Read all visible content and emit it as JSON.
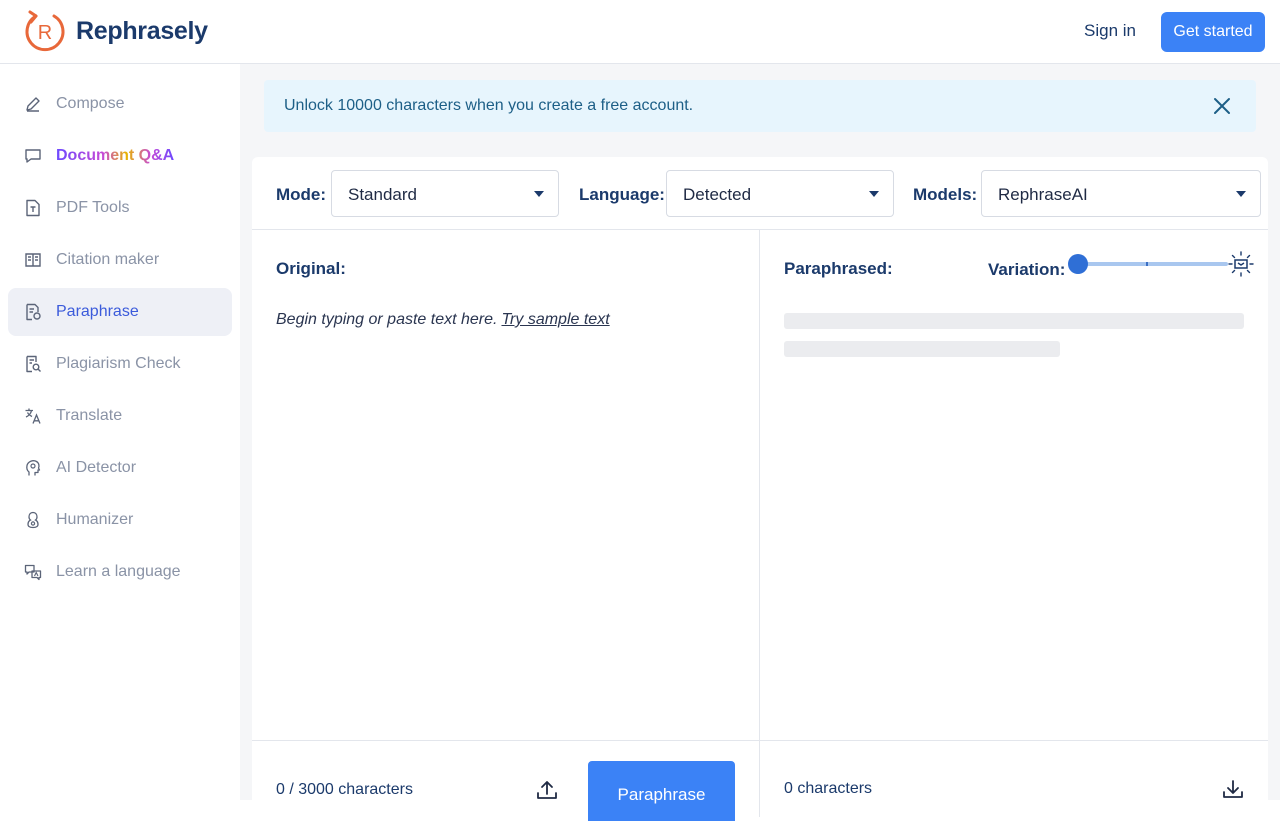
{
  "brand": {
    "name": "Rephrasely",
    "logo_letter": "R",
    "accent_color": "#e8683a",
    "primary_color": "#3b82f6"
  },
  "header": {
    "sign_in": "Sign in",
    "get_started": "Get started"
  },
  "sidebar": {
    "items": [
      {
        "label": "Compose",
        "icon": "pencil-icon"
      },
      {
        "label": "Document Q&A",
        "icon": "chat-bubble-icon"
      },
      {
        "label": "PDF Tools",
        "icon": "pdf-file-icon"
      },
      {
        "label": "Citation maker",
        "icon": "book-icon"
      },
      {
        "label": "Paraphrase",
        "icon": "paraphrase-doc-icon",
        "active": true
      },
      {
        "label": "Plagiarism Check",
        "icon": "plagiarism-search-icon"
      },
      {
        "label": "Translate",
        "icon": "translate-icon"
      },
      {
        "label": "AI Detector",
        "icon": "ai-head-icon"
      },
      {
        "label": "Humanizer",
        "icon": "humanizer-icon"
      },
      {
        "label": "Learn a language",
        "icon": "language-cards-icon"
      }
    ]
  },
  "banner": {
    "text": "Unlock 10000 characters when you create a free account."
  },
  "toolbar": {
    "mode_label": "Mode:",
    "mode_value": "Standard",
    "language_label": "Language:",
    "language_value": "Detected",
    "models_label": "Models:",
    "models_value": "RephraseAI"
  },
  "original": {
    "title": "Original:",
    "placeholder": "Begin typing or paste text here.",
    "sample_link": "Try sample text",
    "char_count": "0 / 3000 characters",
    "paraphrase_button": "Paraphrase"
  },
  "paraphrased": {
    "title": "Paraphrased:",
    "variation_label": "Variation:",
    "variation_level": 0,
    "char_count": "0 characters"
  }
}
